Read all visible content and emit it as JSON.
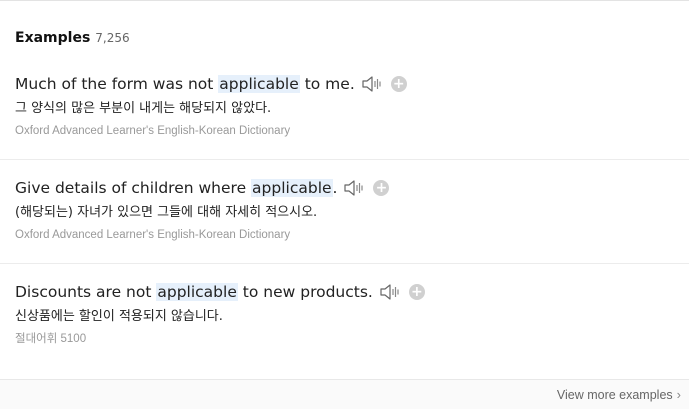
{
  "section": {
    "title": "Examples",
    "count": "7,256"
  },
  "examples": [
    {
      "en_before": "Much of the form was not ",
      "en_highlight": "applicable",
      "en_after": " to me.",
      "ko": "그 양식의 많은 부분이 내게는 해당되지 않았다.",
      "source": "Oxford Advanced Learner's English-Korean Dictionary"
    },
    {
      "en_before": "Give details of children where ",
      "en_highlight": "applicable",
      "en_after": ".",
      "ko": "(해당되는) 자녀가 있으면 그들에 대해 자세히 적으시오.",
      "source": "Oxford Advanced Learner's English-Korean Dictionary"
    },
    {
      "en_before": "Discounts are not ",
      "en_highlight": "applicable",
      "en_after": " to new products.",
      "ko": "신상품에는 할인이 적용되지 않습니다.",
      "source": "절대어휘 5100"
    }
  ],
  "footer": {
    "view_more": "View more examples"
  },
  "icons": {
    "speaker": "speaker-icon",
    "add": "plus-circle-icon",
    "chevron": "chevron-right-icon"
  },
  "colors": {
    "highlight": "#e6f0fb",
    "source_text": "#999999",
    "add_button": "#d0d0d0"
  }
}
